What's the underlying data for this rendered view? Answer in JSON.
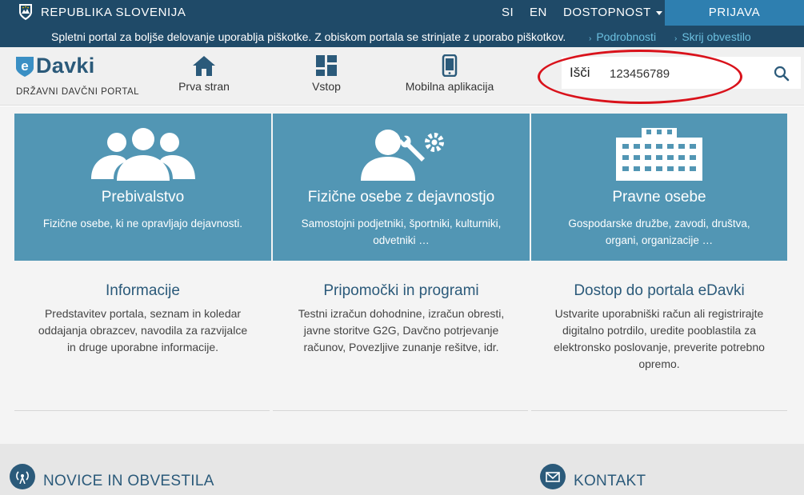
{
  "topbar": {
    "country": "REPUBLIKA SLOVENIJA",
    "lang_si": "SI",
    "lang_en": "EN",
    "accessibility": "DOSTOPNOST",
    "login": "PRIJAVA"
  },
  "cookies": {
    "message": "Spletni portal za boljše delovanje uporablja piškotke. Z obiskom portala se strinjate z uporabo piškotkov.",
    "details": "Podrobnosti",
    "hide": "Skrij obvestilo"
  },
  "header": {
    "logo_name": "Davki",
    "logo_sub": "DRŽAVNI DAVČNI PORTAL",
    "nav": [
      {
        "label": "Prva stran",
        "icon": "home-icon"
      },
      {
        "label": "Vstop",
        "icon": "grid-icon"
      },
      {
        "label": "Mobilna aplikacija",
        "icon": "mobile-icon"
      }
    ],
    "search": {
      "label": "Išči",
      "value": "123456789",
      "icon": "search-icon"
    },
    "annotation_color": "#d9121b"
  },
  "tiles": [
    {
      "title": "Prebivalstvo",
      "desc": "Fizične osebe, ki ne opravljajo dejavnosti.",
      "icon": "people-icon"
    },
    {
      "title": "Fizične osebe z dejavnostjo",
      "desc": "Samostojni podjetniki, športniki, kulturniki, odvetniki …",
      "icon": "person-gears-icon"
    },
    {
      "title": "Pravne osebe",
      "desc": "Gospodarske družbe, zavodi, društva, organi, organizacije …",
      "icon": "building-icon"
    }
  ],
  "info": [
    {
      "title": "Informacije",
      "desc": "Predstavitev portala, seznam in koledar oddajanja obrazcev, navodila za razvijalce in druge uporabne informacije."
    },
    {
      "title": "Pripomočki in programi",
      "desc": "Testni izračun dohodnine, izračun obresti, javne storitve G2G, Davčno potrjevanje računov, Povezljive zunanje rešitve, idr."
    },
    {
      "title": "Dostop do portala eDavki",
      "desc": "Ustvarite uporabniški račun ali registrirajte digitalno potrdilo, uredite pooblastila za elektronsko poslovanje, preverite potrebno opremo."
    }
  ],
  "bottom": {
    "news": "NOVICE IN OBVESTILA",
    "contact": "KONTAKT"
  },
  "colors": {
    "topbar": "#1f4a68",
    "login": "#2e7fb0",
    "tile": "#5296b4",
    "link": "#6cc0e0",
    "heading": "#2b5a7a"
  }
}
